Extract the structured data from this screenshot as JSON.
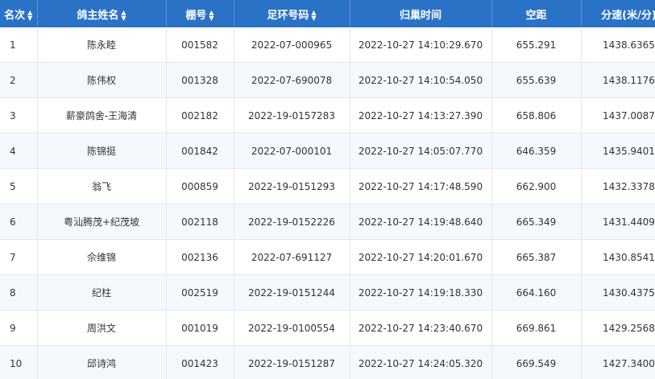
{
  "table": {
    "headers": [
      {
        "label": "名次",
        "sortable": true
      },
      {
        "label": "鸽主姓名",
        "sortable": true
      },
      {
        "label": "棚号",
        "sortable": true
      },
      {
        "label": "足环号码",
        "sortable": true
      },
      {
        "label": "归巢时间",
        "sortable": false
      },
      {
        "label": "空距",
        "sortable": false
      },
      {
        "label": "分速(米/分)",
        "sortable": false
      }
    ],
    "rows": [
      [
        "1",
        "陈永睦",
        "001582",
        "2022-07-000965",
        "2022-10-27 14:10:29.670",
        "655.291",
        "1438.6365"
      ],
      [
        "2",
        "陈伟权",
        "001328",
        "2022-07-690078",
        "2022-10-27 14:10:54.050",
        "655.639",
        "1438.1176"
      ],
      [
        "3",
        "薪豪鸽舍-王海清",
        "002182",
        "2022-19-0157283",
        "2022-10-27 14:13:27.390",
        "658.806",
        "1437.0087"
      ],
      [
        "4",
        "陈锦挺",
        "001842",
        "2022-07-000101",
        "2022-10-27 14:05:07.770",
        "646.359",
        "1435.9401"
      ],
      [
        "5",
        "翁飞",
        "000859",
        "2022-19-0151293",
        "2022-10-27 14:17:48.590",
        "662.900",
        "1432.3378"
      ],
      [
        "6",
        "粤汕腾茂+纪茂坡",
        "002118",
        "2022-19-0152226",
        "2022-10-27 14:19:48.640",
        "665.349",
        "1431.4409"
      ],
      [
        "7",
        "佘维锦",
        "002136",
        "2022-07-691127",
        "2022-10-27 14:20:01.670",
        "665.387",
        "1430.8541"
      ],
      [
        "8",
        "纪柱",
        "002519",
        "2022-19-0151244",
        "2022-10-27 14:19:18.330",
        "664.160",
        "1430.4375"
      ],
      [
        "9",
        "周洪文",
        "001019",
        "2022-19-0100554",
        "2022-10-27 14:23:40.670",
        "669.861",
        "1429.2568"
      ],
      [
        "10",
        "邱诗鸿",
        "001423",
        "2022-19-0151287",
        "2022-10-27 14:24:05.320",
        "669.549",
        "1427.3400"
      ]
    ]
  },
  "colors": {
    "header_bg": "#2a72c6",
    "header_text": "#ffffff",
    "row_alt_bg": "#f5f8fc",
    "border": "#e3e8ef"
  },
  "icons": {
    "sort": "sort-icon"
  }
}
